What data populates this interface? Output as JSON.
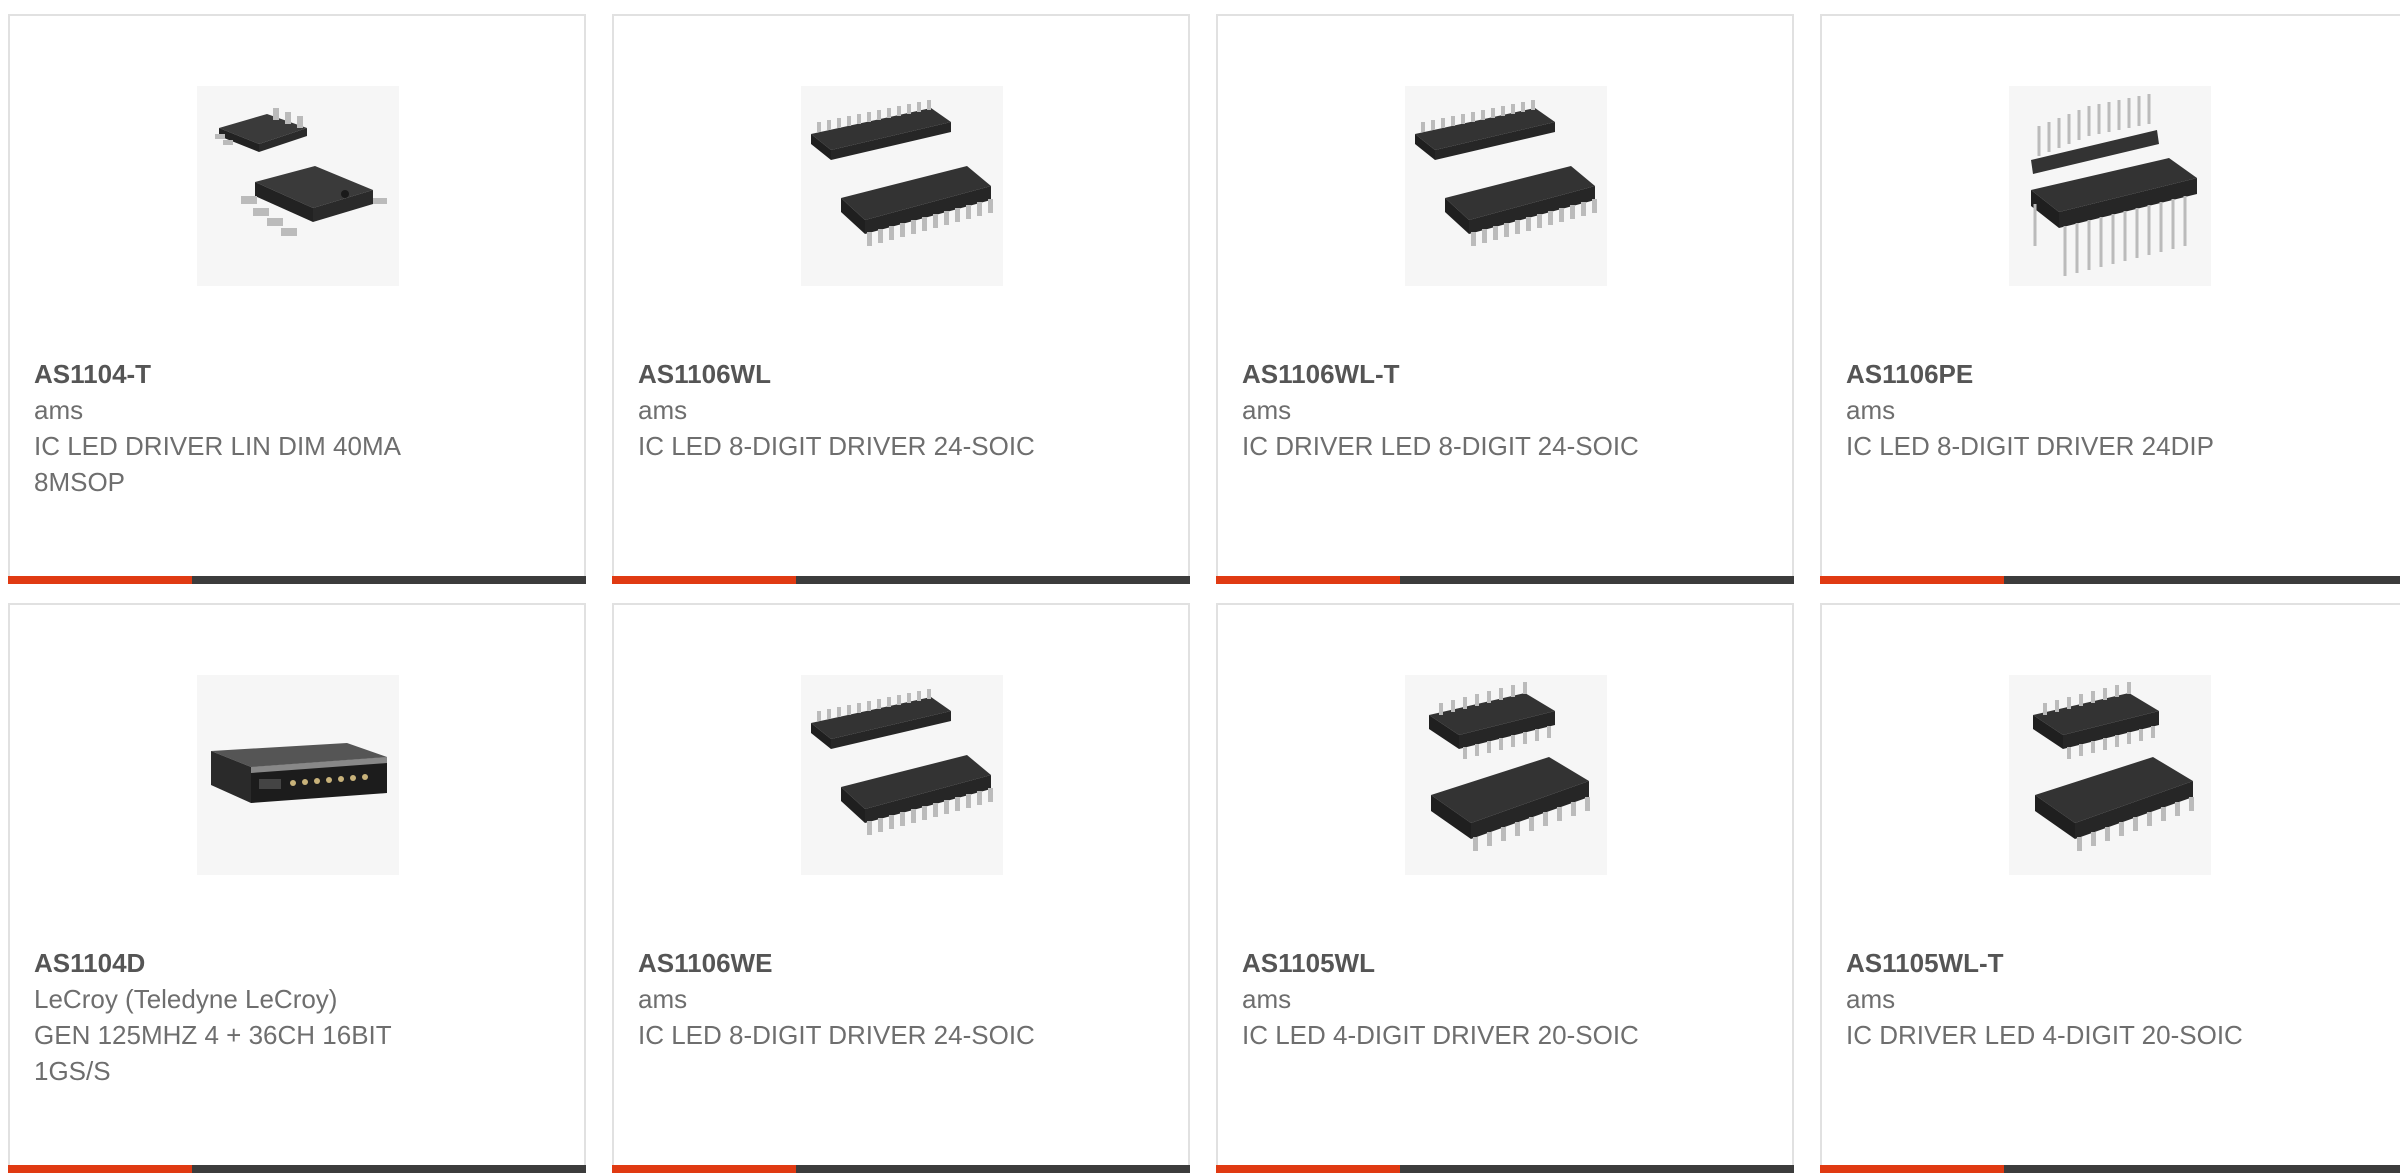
{
  "products": [
    {
      "part": "AS1104-T",
      "brand": "ams",
      "desc": "IC LED DRIVER LIN DIM 40MA 8MSOP",
      "image": "msop-8-package-image"
    },
    {
      "part": "AS1106WL",
      "brand": "ams",
      "desc": "IC LED 8-DIGIT DRIVER 24-SOIC",
      "image": "soic-24-package-image"
    },
    {
      "part": "AS1106WL-T",
      "brand": "ams",
      "desc": "IC DRIVER LED 8-DIGIT 24-SOIC",
      "image": "soic-24-package-image"
    },
    {
      "part": "AS1106PE",
      "brand": "ams",
      "desc": "IC LED 8-DIGIT DRIVER 24DIP",
      "image": "dip-24-package-image"
    },
    {
      "part": "AS1104D",
      "brand": "LeCroy (Teledyne LeCroy)",
      "desc": "GEN 125MHZ 4 + 36CH 16BIT 1GS/S",
      "image": "signal-generator-image"
    },
    {
      "part": "AS1106WE",
      "brand": "ams",
      "desc": "IC LED 8-DIGIT DRIVER 24-SOIC",
      "image": "soic-24-package-image"
    },
    {
      "part": "AS1105WL",
      "brand": "ams",
      "desc": "IC LED 4-DIGIT DRIVER 20-SOIC",
      "image": "soic-20-package-image"
    },
    {
      "part": "AS1105WL-T",
      "brand": "ams",
      "desc": "IC DRIVER LED 4-DIGIT 20-SOIC",
      "image": "soic-20-package-image"
    }
  ],
  "colors": {
    "accent": "#e03a12",
    "bar": "#3c3c3c",
    "border": "#e1e1e1",
    "part_text": "#555555",
    "body_text": "#6e6e6e"
  }
}
